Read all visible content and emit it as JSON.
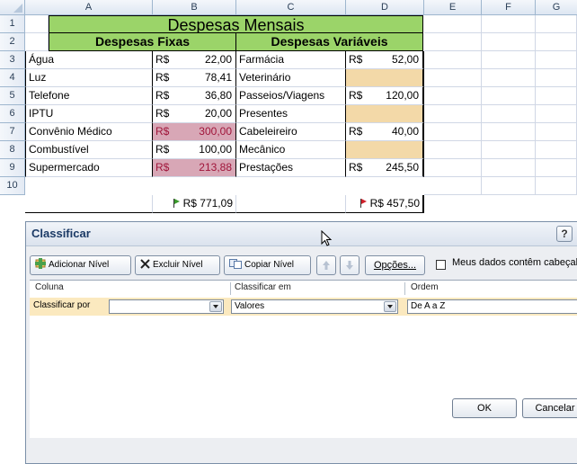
{
  "columns": [
    "A",
    "B",
    "C",
    "D",
    "E",
    "F",
    "G"
  ],
  "rows": [
    "1",
    "2",
    "3",
    "4",
    "5",
    "6",
    "7",
    "8",
    "9",
    "10"
  ],
  "sheet": {
    "title": "Despesas Mensais",
    "fixed_header": "Despesas Fixas",
    "variable_header": "Despesas Variáveis",
    "currency": "R$",
    "fixed_items": [
      {
        "name": "Água",
        "value": "22,00"
      },
      {
        "name": "Luz",
        "value": "78,41"
      },
      {
        "name": "Telefone",
        "value": "36,80"
      },
      {
        "name": "IPTU",
        "value": "20,00"
      },
      {
        "name": "Convênio Médico",
        "value": "300,00"
      },
      {
        "name": "Combustível",
        "value": "100,00"
      },
      {
        "name": "Supermercado",
        "value": "213,88"
      }
    ],
    "variable_items": [
      {
        "name": "Farmácia",
        "value": "52,00"
      },
      {
        "name": "Veterinário",
        "value": ""
      },
      {
        "name": "Passeios/Viagens",
        "value": "120,00"
      },
      {
        "name": "Presentes",
        "value": ""
      },
      {
        "name": "Cabeleireiro",
        "value": "40,00"
      },
      {
        "name": "Mecânico",
        "value": ""
      },
      {
        "name": "Prestações",
        "value": "245,50"
      }
    ],
    "fixed_total": "R$ 771,09",
    "variable_total": "R$ 457,50",
    "colors": {
      "title_fill": "#9bd469",
      "empty_fill": "#f3d9a8",
      "highlight_fill": "#d8a7b6",
      "flag_green": "#3a9a2b",
      "flag_red": "#d0202a"
    }
  },
  "dialog": {
    "title": "Classificar",
    "help": "?",
    "toolbar": {
      "add_level": "Adicionar Nível",
      "delete_level": "Excluir Nível",
      "copy_level": "Copiar Nível",
      "options": "Opções...",
      "my_data_has_headers": "Meus dados contêm cabeçalhos"
    },
    "grid_headers": {
      "column": "Coluna",
      "sort_on": "Classificar em",
      "order": "Ordem"
    },
    "row": {
      "label": "Classificar por",
      "column_value": "",
      "sort_on_value": "Valores",
      "order_value": "De A a Z"
    },
    "buttons": {
      "ok": "OK",
      "cancel": "Cancelar"
    }
  }
}
